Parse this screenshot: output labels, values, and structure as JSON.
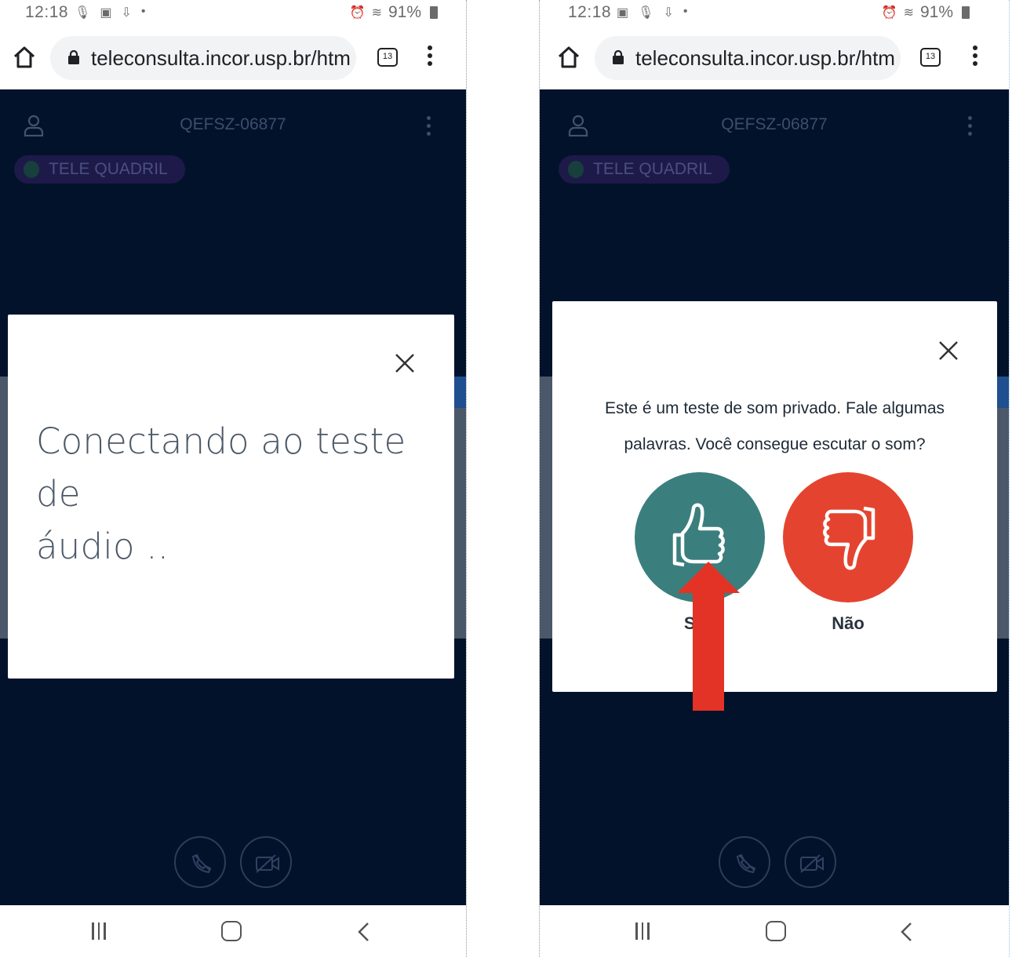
{
  "statusbar": {
    "time": "12:18",
    "battery": "91%"
  },
  "browser": {
    "url": "teleconsulta.incor.usp.br/htm",
    "tab_count": "13"
  },
  "call": {
    "room_code": "QEFSZ-06877",
    "room_name": "TELE QUADRIL"
  },
  "left_modal": {
    "message_line1": "Conectando ao teste de",
    "message_line2": "áudio .."
  },
  "right_modal": {
    "question_line1": "Este é um teste de som privado. Fale algumas",
    "question_line2": "palavras. Você consegue escutar o som?",
    "yes_label": "Sim",
    "no_label": "Não",
    "yes_color": "#3a7f7d",
    "no_color": "#e4442f"
  },
  "icons": [
    "home-icon",
    "lock-icon",
    "tab-switcher-icon",
    "more-options-icon",
    "user-icon",
    "microphone-icon",
    "end-call-icon",
    "camera-off-icon",
    "close-icon",
    "thumbs-up-icon",
    "thumbs-down-icon",
    "recent-apps-icon",
    "home-nav-icon",
    "back-icon",
    "annotation-arrow"
  ],
  "colors": {
    "video_bg": "#03122b",
    "arrow": "#e23326"
  }
}
